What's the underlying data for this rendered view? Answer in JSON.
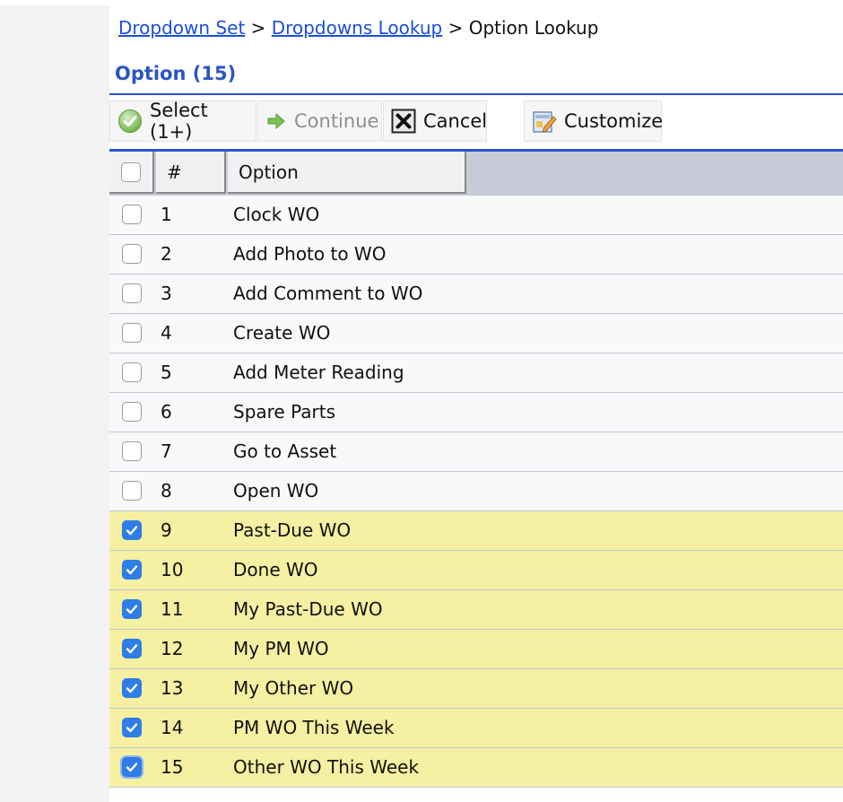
{
  "breadcrumb": {
    "items": [
      {
        "label": "Dropdown Set",
        "link": true
      },
      {
        "label": "Dropdowns Lookup",
        "link": true
      },
      {
        "label": "Option Lookup",
        "link": false
      }
    ],
    "separator": ">"
  },
  "page": {
    "title": "Option (15)"
  },
  "toolbar": {
    "select_label": "Select (1+)",
    "continue_label": "Continue",
    "cancel_label": "Cancel",
    "customize_label": "Customize"
  },
  "table": {
    "headers": {
      "number": "#",
      "option": "Option"
    },
    "rows": [
      {
        "num": "1",
        "option": "Clock WO",
        "checked": false
      },
      {
        "num": "2",
        "option": "Add Photo to WO",
        "checked": false
      },
      {
        "num": "3",
        "option": "Add Comment to WO",
        "checked": false
      },
      {
        "num": "4",
        "option": "Create WO",
        "checked": false
      },
      {
        "num": "5",
        "option": "Add Meter Reading",
        "checked": false
      },
      {
        "num": "6",
        "option": "Spare Parts",
        "checked": false
      },
      {
        "num": "7",
        "option": "Go to Asset",
        "checked": false
      },
      {
        "num": "8",
        "option": "Open WO",
        "checked": false
      },
      {
        "num": "9",
        "option": "Past-Due WO",
        "checked": true
      },
      {
        "num": "10",
        "option": "Done WO",
        "checked": true
      },
      {
        "num": "11",
        "option": "My Past-Due WO",
        "checked": true
      },
      {
        "num": "12",
        "option": "My PM WO",
        "checked": true
      },
      {
        "num": "13",
        "option": "My Other WO",
        "checked": true
      },
      {
        "num": "14",
        "option": "PM WO This Week",
        "checked": true
      },
      {
        "num": "15",
        "option": "Other WO This Week",
        "checked": true
      }
    ]
  },
  "colors": {
    "link": "#1b4fd6",
    "title": "#2a55c4",
    "accent_rule": "#2c55c9",
    "selected_row": "#f5f0a2",
    "checkbox_checked": "#2f7de6"
  },
  "icons": {
    "select": "green-check-circle-icon",
    "continue": "green-arrow-right-icon",
    "cancel": "x-box-icon",
    "customize": "pencil-document-icon"
  }
}
